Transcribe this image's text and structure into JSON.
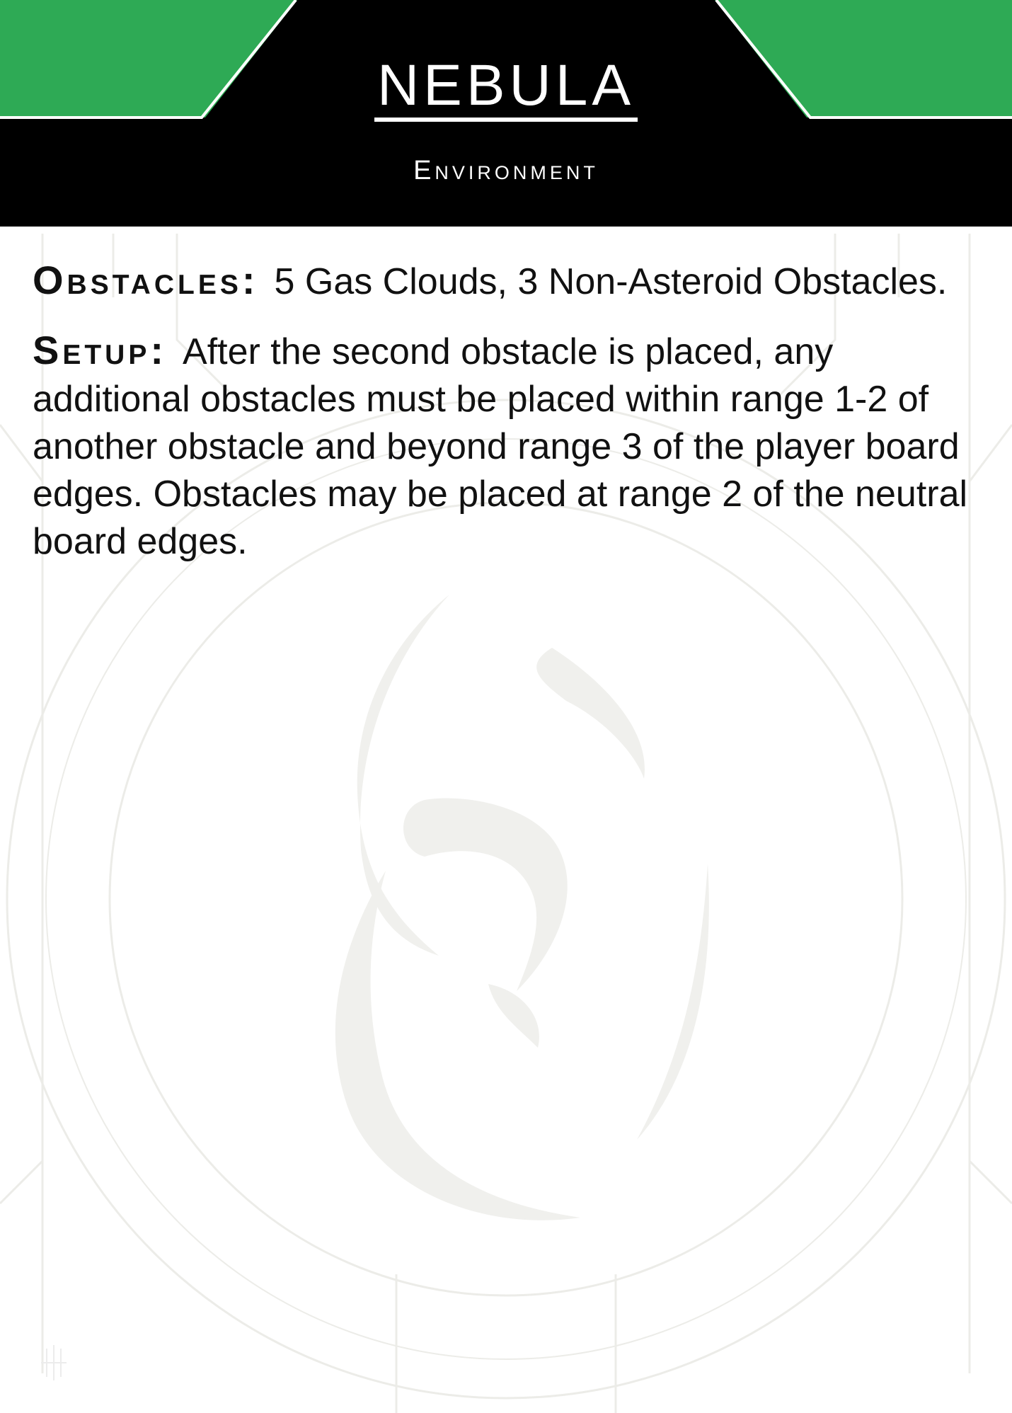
{
  "card": {
    "title": "NEBULA",
    "subtitle": "Environment",
    "sections": [
      {
        "label": "Obstacles:",
        "text": "5 Gas Clouds, 3 Non-Asteroid Obstacles."
      },
      {
        "label": "Setup:",
        "text": "After the second obstacle is placed, any additional obstacles must be placed within range 1-2 of another obstacle and beyond range 3 of the player board edges. Obstacles may be placed at range 2 of the neutral board edges."
      }
    ]
  },
  "colors": {
    "header_band": "#000000",
    "accent_green": "#2eaa55",
    "background": "#ffffff",
    "watermark": "#efefec"
  },
  "icons": {
    "watermark": "faction-emblem-icon",
    "corner_mark": "small-emblem-icon"
  }
}
